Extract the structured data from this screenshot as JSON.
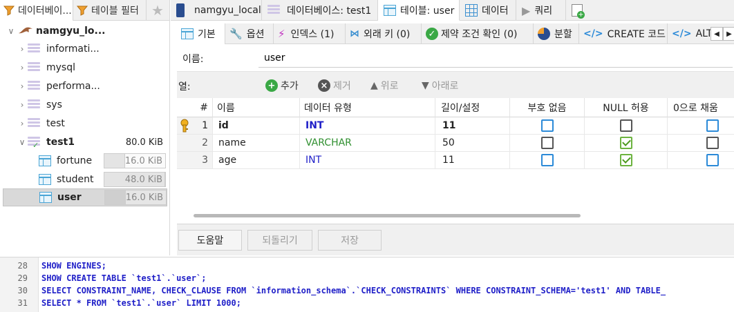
{
  "left_tabs": [
    {
      "label": "데이터베이..."
    },
    {
      "label": "테이블 필터"
    }
  ],
  "tree": {
    "server": "namgyu_lo...",
    "databases": [
      {
        "name": "informati..."
      },
      {
        "name": "mysql"
      },
      {
        "name": "performa..."
      },
      {
        "name": "sys"
      },
      {
        "name": "test"
      }
    ],
    "open_db": {
      "name": "test1",
      "size": "80.0 KiB"
    },
    "tables": [
      {
        "name": "fortune",
        "size": "16.0 KiB"
      },
      {
        "name": "student",
        "size": "48.0 KiB"
      },
      {
        "name": "user",
        "size": "16.0 KiB"
      }
    ]
  },
  "top_tabs": [
    {
      "label": "namgyu_local"
    },
    {
      "label": "데이터베이스: test1"
    },
    {
      "label": "테이블: user"
    },
    {
      "label": "데이터"
    },
    {
      "label": "쿼리"
    }
  ],
  "sub_tabs": [
    {
      "label": "기본"
    },
    {
      "label": "옵션"
    },
    {
      "label": "인덱스 (1)"
    },
    {
      "label": "외래 키 (0)"
    },
    {
      "label": "제약 조건 확인 (0)"
    },
    {
      "label": "분할"
    },
    {
      "label": "CREATE 코드"
    },
    {
      "label": "ALTE"
    }
  ],
  "form": {
    "name_label": "이름:",
    "name_value": "user",
    "columns_label": "열:",
    "add": "추가",
    "remove": "제거",
    "up": "위로",
    "down": "아래로"
  },
  "grid": {
    "headers": [
      "#",
      "이름",
      "데이터 유형",
      "길이/설정",
      "부호 없음",
      "NULL 허용",
      "0으로 채움"
    ],
    "rows": [
      {
        "num": "1",
        "name": "id",
        "type": "INT",
        "length": "11",
        "unsigned": false,
        "nullable": false,
        "zerofill": false,
        "key": true
      },
      {
        "num": "2",
        "name": "name",
        "type": "VARCHAR",
        "length": "50",
        "unsigned": false,
        "nullable": true,
        "zerofill": false,
        "key": false
      },
      {
        "num": "3",
        "name": "age",
        "type": "INT",
        "length": "11",
        "unsigned": false,
        "nullable": true,
        "zerofill": false,
        "key": false
      }
    ]
  },
  "buttons": {
    "help": "도움말",
    "revert": "되돌리기",
    "save": "저장"
  },
  "sql": [
    {
      "line": "28",
      "text": "SHOW ENGINES;"
    },
    {
      "line": "29",
      "text": "SHOW CREATE TABLE `test1`.`user`;"
    },
    {
      "line": "30",
      "text": "SELECT CONSTRAINT_NAME, CHECK_CLAUSE FROM `information_schema`.`CHECK_CONSTRAINTS` WHERE CONSTRAINT_SCHEMA='test1' AND TABLE_"
    },
    {
      "line": "31",
      "text": "SELECT * FROM `test1`.`user` LIMIT 1000;"
    }
  ],
  "colors": {
    "type_int": "#1f1fc8",
    "type_varchar": "#2f8f2f",
    "check_blue": "#2b8ad8",
    "check_green": "#6cb33f",
    "add_green": "#3aa845"
  }
}
